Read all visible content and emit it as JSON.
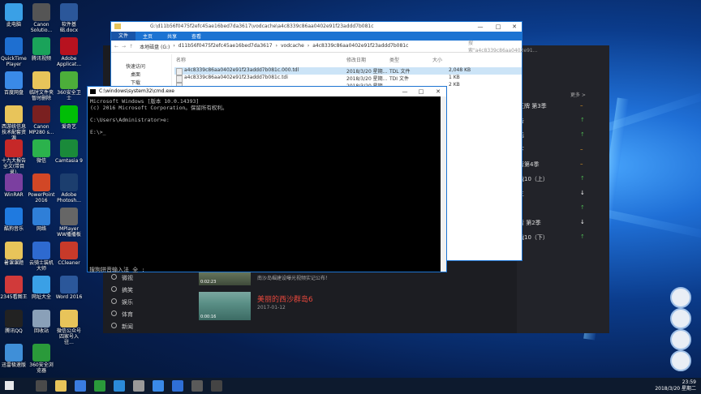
{
  "desktop_icons": [
    {
      "label": "此电脑",
      "color": "#3aa0e6"
    },
    {
      "label": "QuickTime Player",
      "color": "#1e6fd1"
    },
    {
      "label": "百度网盘",
      "color": "#3a8ae8"
    },
    {
      "label": "西游统信息技术配套资源",
      "color": "#e8c45a"
    },
    {
      "label": "十九大报告全文(带目录).",
      "color": "#c62828"
    },
    {
      "label": "WinRAR",
      "color": "#7b3fa0"
    },
    {
      "label": "酷狗音乐",
      "color": "#1f7ae0"
    },
    {
      "label": "暑课课题",
      "color": "#e8c45a"
    },
    {
      "label": "2345看图王",
      "color": "#d13a3a"
    },
    {
      "label": "腾讯QQ",
      "color": "#222"
    },
    {
      "label": "迅雷极速版",
      "color": "#3f8fd8"
    },
    {
      "label": "Canon Solutio...",
      "color": "#555"
    },
    {
      "label": "腾讯视频",
      "color": "#1aa35a"
    },
    {
      "label": "临时文件夹暂时删除",
      "color": "#e8c45a"
    },
    {
      "label": "Canon MP280 s...",
      "color": "#7a2020"
    },
    {
      "label": "微信",
      "color": "#2bb24c"
    },
    {
      "label": "PowerPoint 2016",
      "color": "#d24726"
    },
    {
      "label": "网络",
      "color": "#2f7fd8"
    },
    {
      "label": "云骑士装机大师",
      "color": "#2e6ad0"
    },
    {
      "label": "网址大全",
      "color": "#3aa0e6"
    },
    {
      "label": "回收站",
      "color": "#8aa0b8"
    },
    {
      "label": "360安全浏览器",
      "color": "#2a9a3a"
    },
    {
      "label": "软件基础.docx",
      "color": "#2b579a"
    },
    {
      "label": "Adobe Applicat...",
      "color": "#b7121f"
    },
    {
      "label": "360安全卫士",
      "color": "#4cae3a"
    },
    {
      "label": "爱奇艺",
      "color": "#00be06"
    },
    {
      "label": "Camtasia 9",
      "color": "#1a8a3a"
    },
    {
      "label": "Adobe Photosh...",
      "color": "#1c3e6e"
    },
    {
      "label": "MPlayer WW播播板",
      "color": "#666"
    },
    {
      "label": "CCleaner",
      "color": "#c83a2a"
    },
    {
      "label": "Word 2016",
      "color": "#2b579a"
    },
    {
      "label": "微信公众号四家号入驻...",
      "color": "#e8c45a"
    }
  ],
  "explorer": {
    "title_path": "G:\\d11b56f0475f2efc45ae16bed7da3617\\vodcache\\a4c8339c86aa0402e91f23addd7b081c",
    "ribbon_tabs": [
      "文件",
      "主页",
      "共享",
      "查看"
    ],
    "breadcrumb": [
      "本地磁盘 (G:)",
      "d11b56f0475f2efc45ae16bed7da3617",
      "vodcache",
      "a4c8339c86aa0402e91f23addd7b081c"
    ],
    "search_placeholder": "搜索\"a4c8339c86aa0402e91...",
    "nav": [
      "快速访问",
      "桌面",
      "下载"
    ],
    "columns": [
      "名称",
      "修改日期",
      "类型",
      "大小"
    ],
    "files": [
      {
        "name": "a4c8339c86aa0402e91f23addd7b081c.000.tdl",
        "date": "2018/3/20 星期...",
        "type": "TDL 文件",
        "size": "2,048 KB"
      },
      {
        "name": "a4c8339c86aa0402e91f23addd7b081c.tdi",
        "date": "2018/3/20 星期...",
        "type": "TDI 文件",
        "size": "1 KB"
      },
      {
        "name": "",
        "date": "2018/3/20 星期...",
        "type": "",
        "size": "2 KB"
      }
    ]
  },
  "cmd": {
    "title": "C:\\windows\\system32\\cmd.exe",
    "lines": [
      "Microsoft Windows [版本 10.0.14393]",
      "(c) 2016 Microsoft Corporation。保留所有权利。",
      "",
      "C:\\Users\\Administrator>e:",
      "",
      "E:\\>_"
    ],
    "ime_text": "搜狗拼音输入法 全 :"
  },
  "video_app": {
    "menu_more": "更多 >",
    "ranks": [
      {
        "label": "王牌 第3季",
        "trend": "–",
        "color": "#f5a623"
      },
      {
        "label": "击",
        "trend": "↑",
        "color": "#4caf50"
      },
      {
        "label": "话",
        "trend": "↑",
        "color": "#4caf50"
      },
      {
        "label": "下",
        "trend": "–",
        "color": "#f5a623"
      },
      {
        "label": "音第4季",
        "trend": "–",
        "color": "#f5a623"
      },
      {
        "label": "战10（上）",
        "trend": "↑",
        "color": "#4caf50"
      },
      {
        "label": "三",
        "trend": "↓",
        "color": "#ffffff"
      },
      {
        "label": "",
        "trend": "↑",
        "color": "#4caf50"
      },
      {
        "label": "音 第2季",
        "trend": "↓",
        "color": "#ffffff"
      },
      {
        "label": "战10（下）",
        "trend": "↑",
        "color": "#4caf50"
      }
    ],
    "categories": [
      "微视",
      "搞笑",
      "娱乐",
      "体育",
      "新闻"
    ],
    "videos": [
      {
        "duration": "0:02:23",
        "desc": "南沙岛崛建设曝光视频实记公布！",
        "title": "",
        "date": ""
      },
      {
        "duration": "0:00:16",
        "desc": "",
        "title": "美丽的西沙群岛6",
        "date": "2017-01-12"
      }
    ]
  },
  "taskbar": {
    "time": "23:59",
    "date": "2018/3/20 星期二"
  }
}
